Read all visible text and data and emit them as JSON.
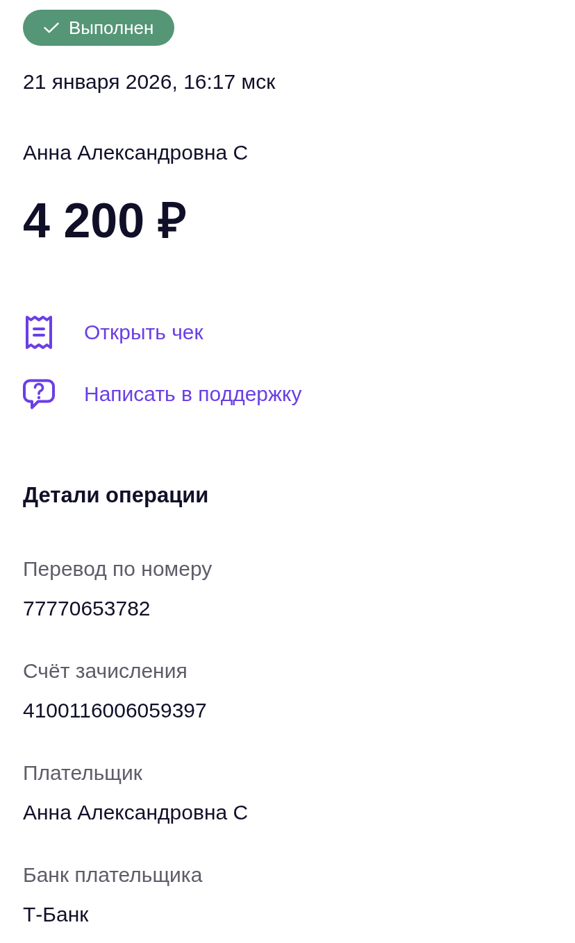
{
  "status": {
    "kind": "success",
    "label": "Выполнен"
  },
  "datetime": "21 января 2026, 16:17 мск",
  "counterparty": "Анна Александровна С",
  "amount": "4 200 ₽",
  "actions": [
    {
      "kind": "receipt",
      "label": "Открыть чек"
    },
    {
      "kind": "support",
      "label": "Написать в поддержку"
    }
  ],
  "details": {
    "title": "Детали операции",
    "rows": [
      {
        "label": "Перевод по номеру",
        "value": "77770653782"
      },
      {
        "label": "Счёт зачисления",
        "value": "4100116006059397"
      },
      {
        "label": "Плательщик",
        "value": "Анна Александровна С"
      },
      {
        "label": "Банк плательщика",
        "value": "Т-Банк"
      }
    ]
  }
}
